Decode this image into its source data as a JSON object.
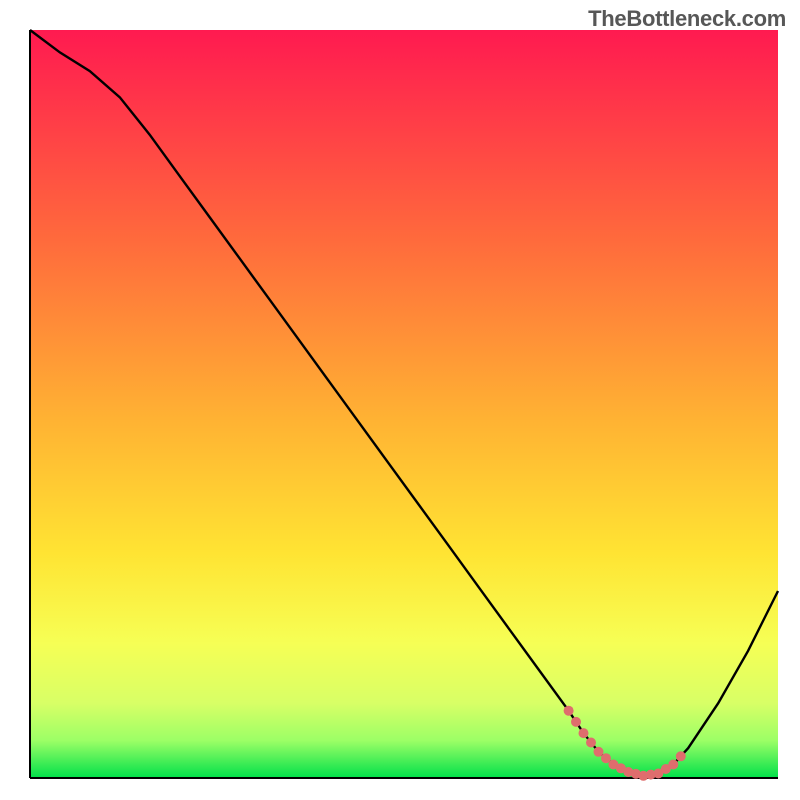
{
  "attribution": "TheBottleneck.com",
  "colors": {
    "gradient_top": "#ff1a50",
    "gradient_mid": "#ffcc33",
    "gradient_lime": "#eaff66",
    "gradient_green": "#00e04a",
    "curve": "#000000",
    "flat_marker": "#df6d6d",
    "axis": "#000000"
  },
  "chart_data": {
    "type": "line",
    "title": "",
    "xlabel": "",
    "ylabel": "",
    "xlim": [
      0,
      100
    ],
    "ylim": [
      0,
      100
    ],
    "grid": false,
    "legend": false,
    "series": [
      {
        "name": "bottleneck-curve",
        "x": [
          0,
          4,
          8,
          12,
          16,
          20,
          24,
          28,
          32,
          36,
          40,
          44,
          48,
          52,
          56,
          60,
          64,
          68,
          72,
          74,
          76,
          78,
          80,
          82,
          84,
          86,
          88,
          92,
          96,
          100
        ],
        "y": [
          100,
          97,
          94.5,
          91,
          86,
          80.5,
          75,
          69.5,
          64,
          58.5,
          53,
          47.5,
          42,
          36.5,
          31,
          25.5,
          20,
          14.5,
          9,
          6,
          3.5,
          1.8,
          0.8,
          0.3,
          0.6,
          1.8,
          4,
          10,
          17,
          25
        ]
      }
    ],
    "annotations": [
      {
        "name": "optimal-region-marker",
        "x_range": [
          72,
          87
        ],
        "style": "dotted-salmon"
      }
    ]
  }
}
